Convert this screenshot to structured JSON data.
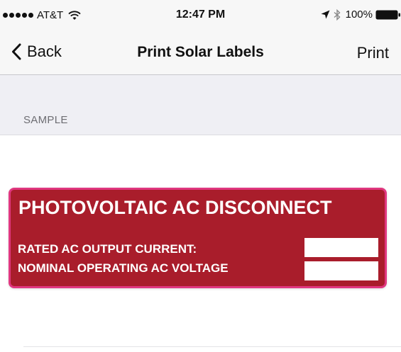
{
  "status_bar": {
    "carrier": "AT&T",
    "time": "12:47 PM",
    "battery": "100%",
    "icons": [
      "signal-dots-icon",
      "wifi-icon",
      "location-arrow-icon",
      "bluetooth-icon",
      "battery-icon"
    ]
  },
  "nav": {
    "back_label": "Back",
    "title": "Print Solar Labels",
    "action_label": "Print"
  },
  "section": {
    "header": "SAMPLE"
  },
  "label": {
    "title": "PHOTOVOLTAIC AC DISCONNECT",
    "rows": [
      {
        "text": "RATED AC OUTPUT CURRENT:",
        "value": ""
      },
      {
        "text": "NOMINAL OPERATING AC VOLTAGE",
        "value": ""
      }
    ],
    "colors": {
      "background": "#a91d2b",
      "border": "#e0377f",
      "text": "#ffffff"
    }
  }
}
